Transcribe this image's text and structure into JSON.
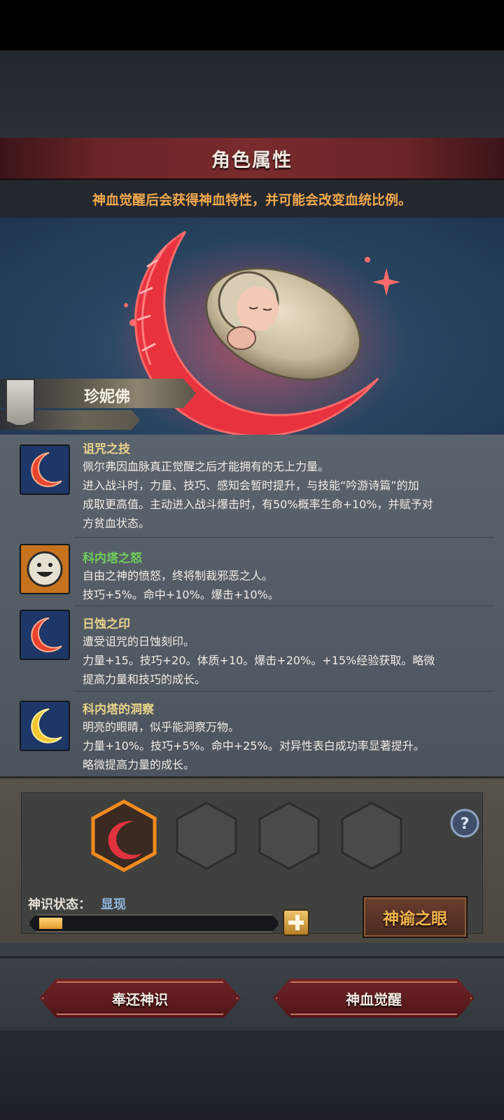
{
  "panel": {
    "title": "角色属性",
    "subtitle": "神血觉醒后会获得神血特性，并可能会改变血统比例。"
  },
  "character": {
    "name": "珍妮佛"
  },
  "traits": [
    {
      "name": "诅咒之技",
      "name_color": "#e8d38a",
      "icon": "red-crescent-icon",
      "lines": [
        "佩尔弗因血脉真正觉醒之后才能拥有的无上力量。",
        "进入战斗时，力量、技巧、感知会暂时提升，与技能“吟游诗篇”的加",
        "成取更高值。主动进入战斗爆击时，有50%概率生命+10%，并赋予对",
        "方贫血状态。"
      ]
    },
    {
      "name": "科内塔之怒",
      "name_color": "#6fcf5a",
      "icon": "grinning-face-icon",
      "lines": [
        "自由之神的愤怒，终将制裁邪恶之人。",
        "技巧+5%。命中+10%。爆击+10%。"
      ]
    },
    {
      "name": "日蚀之印",
      "name_color": "#e8d38a",
      "icon": "red-crescent-icon",
      "lines": [
        "遭受诅咒的日蚀刻印。",
        "力量+15。技巧+20。体质+10。爆击+20%。+15%经验获取。略微",
        "提高力量和技巧的成长。"
      ]
    },
    {
      "name": "科内塔的洞察",
      "name_color": "#e8d38a",
      "icon": "yellow-crescent-icon",
      "lines": [
        "明亮的眼睛，似乎能洞察万物。",
        "力量+10%。技巧+5%。命中+25%。对异性表白成功率显著提升。",
        "略微提高力量的成长。"
      ]
    }
  ],
  "status": {
    "label": "神识状态：",
    "value": "显现",
    "progress": 0.1
  },
  "buttons": {
    "eye": "神谕之眼",
    "return": "奉还神识",
    "awaken": "神血觉醒"
  }
}
